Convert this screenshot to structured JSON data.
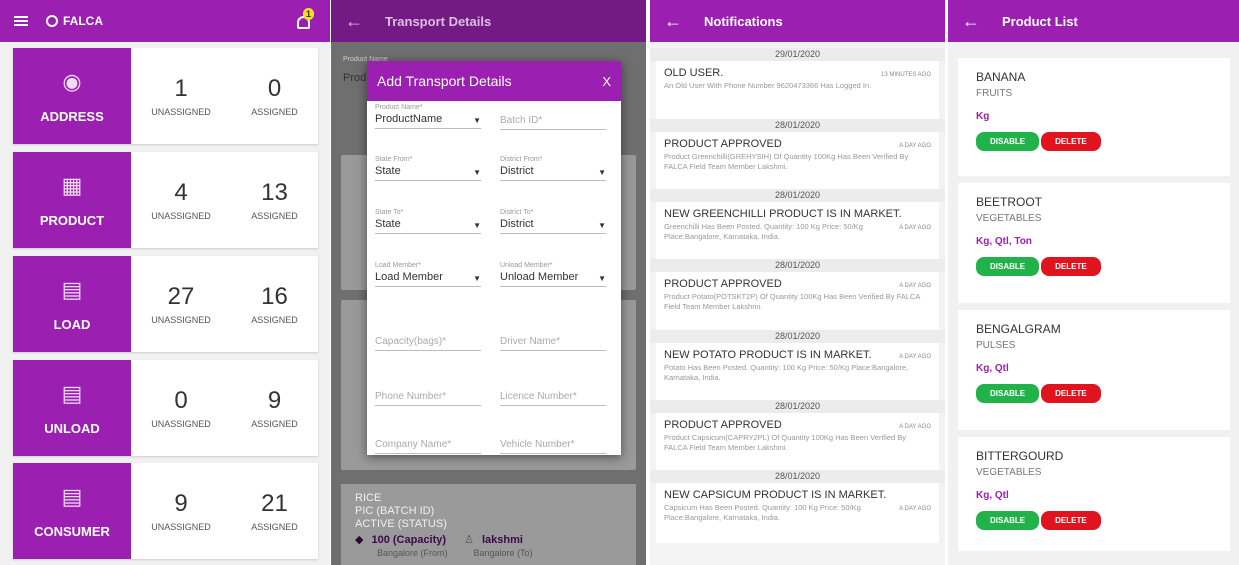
{
  "dashboard": {
    "brand": "FALCA",
    "notification_count": "1",
    "cards": [
      {
        "name": "ADDRESS",
        "icon": "fingerprint-icon",
        "unassigned": "1",
        "assigned": "0"
      },
      {
        "name": "PRODUCT",
        "icon": "grain-icon",
        "unassigned": "4",
        "assigned": "13"
      },
      {
        "name": "LOAD",
        "icon": "clipboard-icon",
        "unassigned": "27",
        "assigned": "16"
      },
      {
        "name": "UNLOAD",
        "icon": "clipboard-icon",
        "unassigned": "0",
        "assigned": "9"
      },
      {
        "name": "CONSUMER",
        "icon": "clipboard-icon",
        "unassigned": "9",
        "assigned": "21"
      }
    ],
    "unassigned_label": "UNASSIGNED",
    "assigned_label": "ASSIGNED"
  },
  "transport": {
    "title": "Transport Details",
    "bg_label": "Product Name",
    "bg_value": "Prod",
    "dialog": {
      "title": "Add Transport Details",
      "close": "X",
      "product_name_label": "Product Name*",
      "product_name_value": "ProductName",
      "batch_id_placeholder": "Batch ID*",
      "state_from_label": "State From*",
      "state_from_value": "State",
      "district_from_label": "District From*",
      "district_from_value": "District",
      "state_to_label": "State To*",
      "state_to_value": "State",
      "district_to_label": "District To*",
      "district_to_value": "District",
      "load_member_label": "Load Member*",
      "load_member_value": "Load Member",
      "unload_member_label": "Unload Member*",
      "unload_member_value": "Unload Member",
      "capacity_placeholder": "Capacity(bags)*",
      "driver_placeholder": "Driver Name*",
      "phone_placeholder": "Phone Number*",
      "licence_placeholder": "Licence Number*",
      "company_placeholder": "Company Name*",
      "vehicle_placeholder": "Vehicle Number*"
    },
    "bottom": {
      "name": "RICE",
      "batch": "PIC (BATCH ID)",
      "status": "ACTIVE (STATUS)",
      "capacity": "100 (Capacity)",
      "member": "lakshmi",
      "from": "Bangalore (From)",
      "to": "Bangalore (To)"
    }
  },
  "notifications": {
    "title": "Notifications",
    "items": [
      {
        "date": "29/01/2020",
        "title": "OLD USER.",
        "time": "13 MINUTES AGO",
        "body": "An Old User With Phone Number 9620473366 Has Logged In."
      },
      {
        "date": "28/01/2020",
        "title": "PRODUCT APPROVED",
        "time": "A DAY AGO",
        "body": "Product Greenchilli(GREHYSIH) Of Quantity 100Kg Has Been Verified By FALCA Field Team Member Lakshmi."
      },
      {
        "date": "28/01/2020",
        "title": "NEW GREENCHILLI PRODUCT IS IN MARKET.",
        "time": "A DAY AGO",
        "body": "Greenchilli Has Been Posted. Quantity: 100 Kg Price: 50/Kg Place:Bangalore, Karnataka, India."
      },
      {
        "date": "28/01/2020",
        "title": "PRODUCT APPROVED",
        "time": "A DAY AGO",
        "body": "Product Potato(POTSKT2P) Of Quantity 100Kg Has Been Verified By FALCA Field Team Member Lakshmi."
      },
      {
        "date": "28/01/2020",
        "title": "NEW POTATO PRODUCT IS IN MARKET.",
        "time": "A DAY AGO",
        "body": "Potato Has Been Posted. Quantity: 100 Kg Price: 50/Kg Place:Bangalore, Karnataka, India."
      },
      {
        "date": "28/01/2020",
        "title": "PRODUCT APPROVED",
        "time": "A DAY AGO",
        "body": "Product Capsicum(CAPRY2PL) Of Quantity 100Kg Has Been Verified By FALCA Field Team Member Lakshmi."
      },
      {
        "date": "28/01/2020",
        "title": "NEW CAPSICUM PRODUCT IS IN MARKET.",
        "time": "A DAY AGO",
        "body": "Capsicum Has Been Posted. Quantity: 100 Kg Price: 50/Kg Place:Bangalore, Karnataka, India."
      }
    ]
  },
  "products": {
    "title": "Product List",
    "disable_label": "DISABLE",
    "delete_label": "DELETE",
    "items": [
      {
        "name": "BANANA",
        "category": "FRUITS",
        "units": "Kg"
      },
      {
        "name": "BEETROOT",
        "category": "VEGETABLES",
        "units": "Kg, Qtl, Ton"
      },
      {
        "name": "BENGALGRAM",
        "category": "PULSES",
        "units": "Kg, Qtl"
      },
      {
        "name": "BITTERGOURD",
        "category": "VEGETABLES",
        "units": "Kg, Qtl"
      }
    ]
  }
}
